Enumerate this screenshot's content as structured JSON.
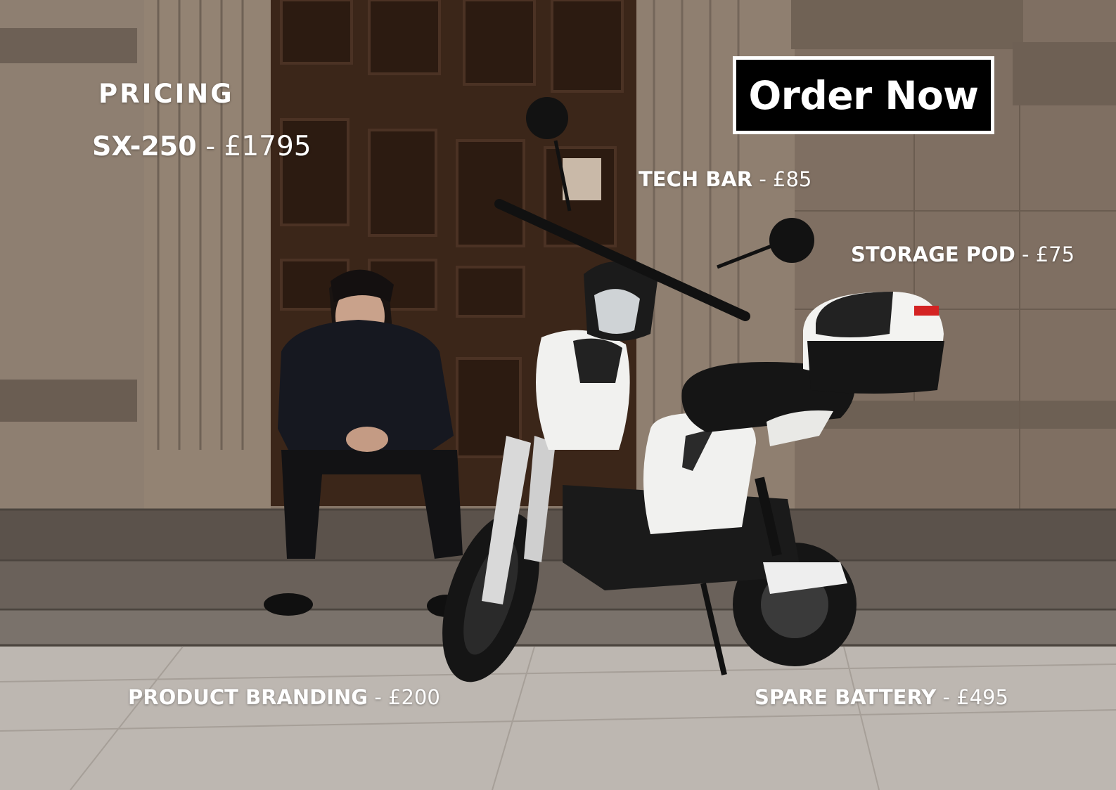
{
  "pricing": {
    "heading": "PRICING",
    "model": "SX-250",
    "model_price": " - £1795"
  },
  "order_button": {
    "label": "Order Now"
  },
  "addons": {
    "tech_bar": {
      "name": "TECH BAR",
      "price": " - £85"
    },
    "storage_pod": {
      "name": "STORAGE POD",
      "price": " - £75"
    },
    "product_branding": {
      "name": "PRODUCT BRANDING",
      "price": " - £200"
    },
    "spare_battery": {
      "name": "SPARE BATTERY",
      "price": " - £495"
    }
  },
  "photo": {
    "subject": "man seated on stone steps beside white electric scooter with top box",
    "colors": {
      "stone": "#8a7a6c",
      "door": "#3a2418",
      "pavement": "#bdb7b1",
      "scooter_white": "#f1f1ef",
      "scooter_black": "#151515"
    }
  }
}
